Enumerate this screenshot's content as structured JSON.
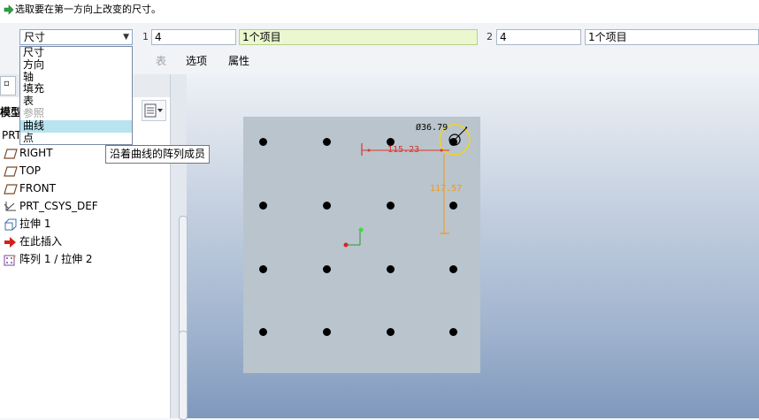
{
  "prompt": {
    "text": "选取要在第一方向上改变的尺寸。"
  },
  "dashboard": {
    "type_combo_value": "尺寸",
    "dir1_index": "1",
    "dir1_count": "4",
    "dir1_items": "1个项目",
    "dir2_index": "2",
    "dir2_count": "4",
    "dir2_items": "1个项目",
    "tabs": [
      "表",
      "选项",
      "属性"
    ]
  },
  "dropdown": {
    "items": [
      {
        "label": "尺寸",
        "state": "normal"
      },
      {
        "label": "方向",
        "state": "normal"
      },
      {
        "label": "轴",
        "state": "normal"
      },
      {
        "label": "填充",
        "state": "normal"
      },
      {
        "label": "表",
        "state": "normal"
      },
      {
        "label": "参照",
        "state": "disabled"
      },
      {
        "label": "曲线",
        "state": "selected"
      },
      {
        "label": "点",
        "state": "normal"
      }
    ]
  },
  "tooltip": {
    "text": "沿着曲线的阵列成员"
  },
  "model_tree": {
    "tab_label": "模型",
    "root_label": "PRT",
    "items": [
      {
        "label": "RIGHT",
        "icon": "datum-plane-icon"
      },
      {
        "label": "TOP",
        "icon": "datum-plane-icon"
      },
      {
        "label": "FRONT",
        "icon": "datum-plane-icon"
      },
      {
        "label": "PRT_CSYS_DEF",
        "icon": "csys-icon"
      },
      {
        "label": "拉伸 1",
        "icon": "extrude-icon"
      },
      {
        "label": "在此插入",
        "icon": "insert-here-arrow-icon"
      },
      {
        "label": "阵列 1 / 拉伸 2",
        "icon": "pattern-icon"
      }
    ]
  },
  "graphics": {
    "dim_diameter": "Ø36.79",
    "dim_horizontal": "115.23",
    "dim_vertical": "117.57",
    "hole_rows": 4,
    "hole_cols": 4
  },
  "colors": {
    "field_green": "#eaf7cf",
    "dropdown_selected": "#b7e4ee",
    "dim_red": "#e0332b",
    "dim_orange": "#f29a1c",
    "part_gray": "#b9c4cc"
  }
}
